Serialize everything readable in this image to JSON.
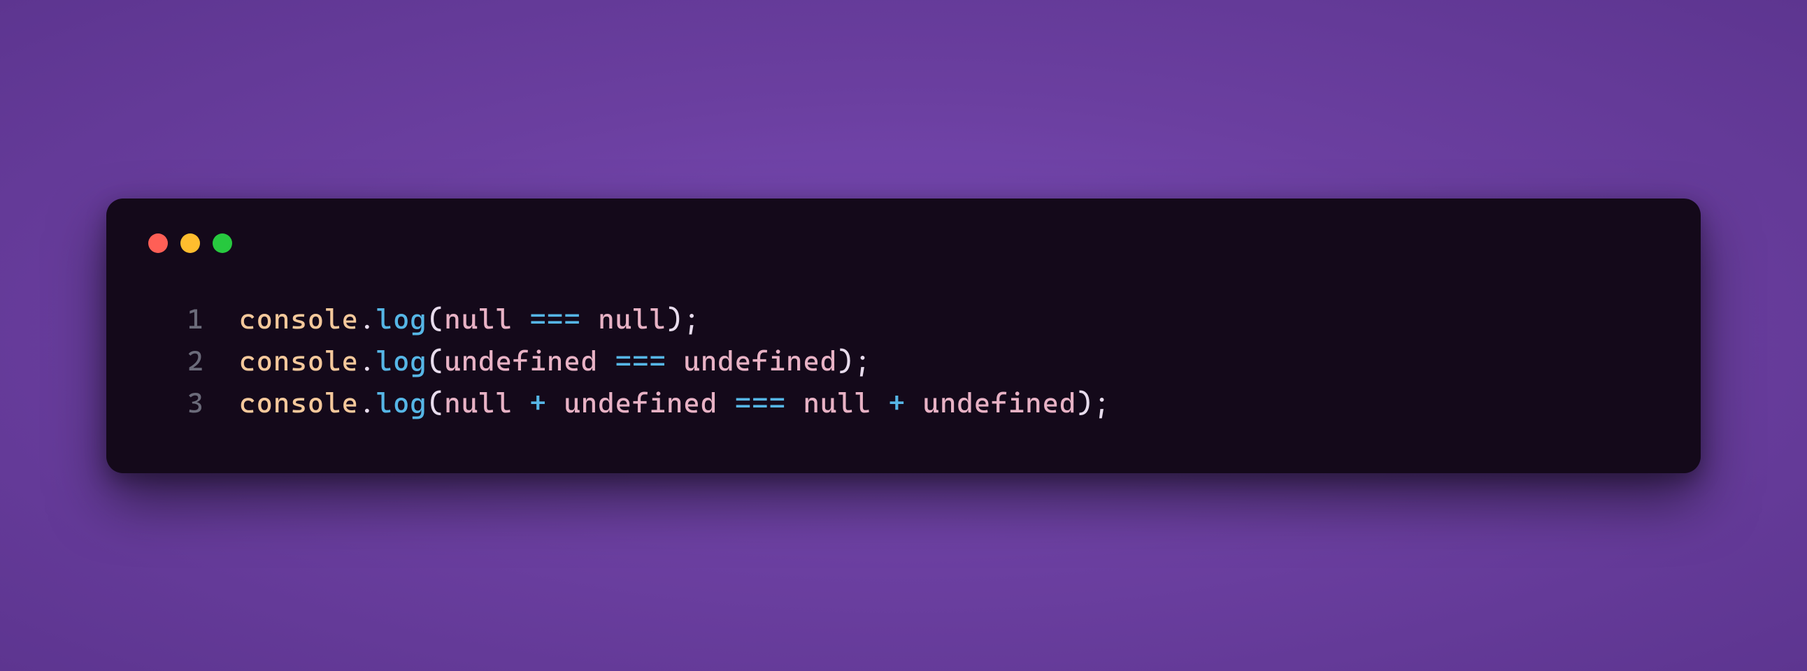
{
  "colors": {
    "background_gradient_center": "#7C4DBA",
    "background_gradient_edge": "#5D3590",
    "window_bg": "#14091A",
    "lineno": "#6B6B7A",
    "object": "#F4C89B",
    "punctuation": "#E8DCED",
    "method": "#56B6E6",
    "keyword": "#E8B2C5",
    "operator": "#56B6E6",
    "dot_red": "#FF5F56",
    "dot_yellow": "#FFBD2E",
    "dot_green": "#27C93F"
  },
  "lines": [
    {
      "n": "1",
      "tokens": [
        {
          "cls": "tok-obj",
          "t": "console"
        },
        {
          "cls": "tok-punc",
          "t": "."
        },
        {
          "cls": "tok-method",
          "t": "log"
        },
        {
          "cls": "tok-punc",
          "t": "("
        },
        {
          "cls": "tok-keyword",
          "t": "null"
        },
        {
          "cls": "tok-punc",
          "t": " "
        },
        {
          "cls": "tok-op",
          "t": "==="
        },
        {
          "cls": "tok-punc",
          "t": " "
        },
        {
          "cls": "tok-keyword",
          "t": "null"
        },
        {
          "cls": "tok-punc",
          "t": ");"
        }
      ]
    },
    {
      "n": "2",
      "tokens": [
        {
          "cls": "tok-obj",
          "t": "console"
        },
        {
          "cls": "tok-punc",
          "t": "."
        },
        {
          "cls": "tok-method",
          "t": "log"
        },
        {
          "cls": "tok-punc",
          "t": "("
        },
        {
          "cls": "tok-keyword",
          "t": "undefined"
        },
        {
          "cls": "tok-punc",
          "t": " "
        },
        {
          "cls": "tok-op",
          "t": "==="
        },
        {
          "cls": "tok-punc",
          "t": " "
        },
        {
          "cls": "tok-keyword",
          "t": "undefined"
        },
        {
          "cls": "tok-punc",
          "t": ");"
        }
      ]
    },
    {
      "n": "3",
      "tokens": [
        {
          "cls": "tok-obj",
          "t": "console"
        },
        {
          "cls": "tok-punc",
          "t": "."
        },
        {
          "cls": "tok-method",
          "t": "log"
        },
        {
          "cls": "tok-punc",
          "t": "("
        },
        {
          "cls": "tok-keyword",
          "t": "null"
        },
        {
          "cls": "tok-punc",
          "t": " "
        },
        {
          "cls": "tok-op",
          "t": "+"
        },
        {
          "cls": "tok-punc",
          "t": " "
        },
        {
          "cls": "tok-keyword",
          "t": "undefined"
        },
        {
          "cls": "tok-punc",
          "t": " "
        },
        {
          "cls": "tok-op",
          "t": "==="
        },
        {
          "cls": "tok-punc",
          "t": " "
        },
        {
          "cls": "tok-keyword",
          "t": "null"
        },
        {
          "cls": "tok-punc",
          "t": " "
        },
        {
          "cls": "tok-op",
          "t": "+"
        },
        {
          "cls": "tok-punc",
          "t": " "
        },
        {
          "cls": "tok-keyword",
          "t": "undefined"
        },
        {
          "cls": "tok-punc",
          "t": ");"
        }
      ]
    }
  ]
}
